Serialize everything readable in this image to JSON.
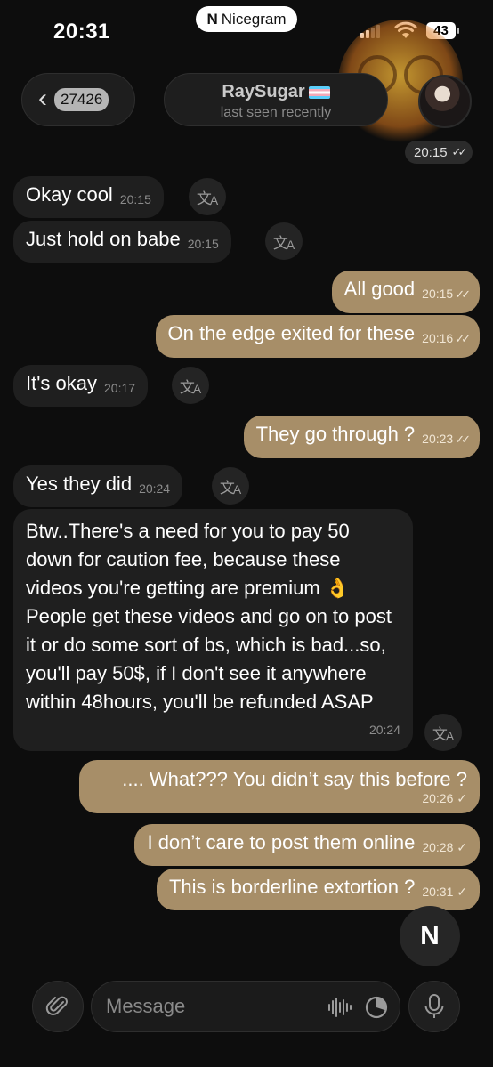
{
  "status_bar": {
    "time": "20:31",
    "island_label": "Nicegram",
    "battery": "43"
  },
  "header": {
    "back_count": "27426",
    "contact_name": "RaySugar",
    "contact_status": "last seen recently",
    "top_time": "20:15"
  },
  "messages": [
    {
      "dir": "in",
      "text": "Okay cool",
      "time": "20:15"
    },
    {
      "dir": "in",
      "text": "Just hold on babe",
      "time": "20:15"
    },
    {
      "dir": "out",
      "text": "All good",
      "time": "20:15"
    },
    {
      "dir": "out",
      "text": "On the edge exited for these",
      "time": "20:16"
    },
    {
      "dir": "in",
      "text": "It's okay",
      "time": "20:17"
    },
    {
      "dir": "out",
      "text": "They go through ?",
      "time": "20:23"
    },
    {
      "dir": "in",
      "text": "Yes they did",
      "time": "20:24"
    },
    {
      "dir": "in",
      "text": "Btw..There's a need for you to pay 50 down for caution fee, because these videos you're getting are premium 👌 People get these videos and go on to post it or do some sort of bs, which is bad...so, you'll pay 50$, if I don't see it anywhere within 48hours, you'll be refunded ASAP",
      "time": "20:24"
    },
    {
      "dir": "out",
      "text": ".... What??? You didn’t say this before ?",
      "time": "20:26"
    },
    {
      "dir": "out",
      "text": "I don’t care to post them online",
      "time": "20:28"
    },
    {
      "dir": "out",
      "text": "This is borderline extortion ?",
      "time": "20:31"
    }
  ],
  "input_bar": {
    "placeholder": "Message"
  },
  "icons": {
    "back": "chevron-left-icon",
    "translate": "translate-icon",
    "attach": "paperclip-icon",
    "voice": "waveform-icon",
    "timer": "timer-icon",
    "mic": "microphone-icon",
    "nicegram": "nicegram-logo-icon"
  },
  "colors": {
    "outgoing_bubble": "#a78e68",
    "incoming_bubble": "#1f1f1f",
    "background": "#0d0d0d"
  }
}
